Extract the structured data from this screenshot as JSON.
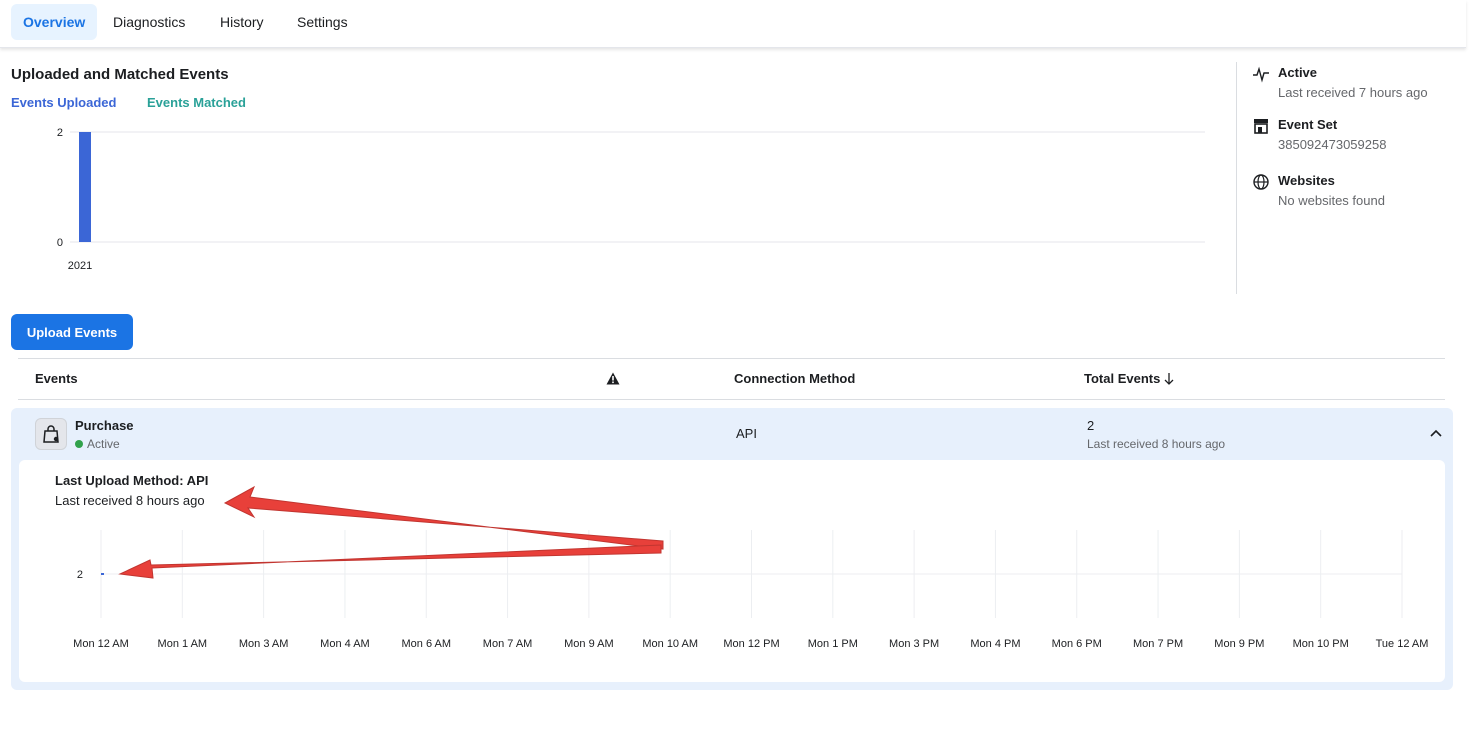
{
  "tabs": [
    {
      "label": "Overview",
      "active": true
    },
    {
      "label": "Diagnostics",
      "active": false
    },
    {
      "label": "History",
      "active": false
    },
    {
      "label": "Settings",
      "active": false
    }
  ],
  "overview_chart": {
    "title": "Uploaded and Matched Events",
    "legend": {
      "uploaded": "Events Uploaded",
      "matched": "Events Matched"
    }
  },
  "info_panel": {
    "active": {
      "title": "Active",
      "sub": "Last received 7 hours ago"
    },
    "event_set": {
      "title": "Event Set",
      "sub": "385092473059258"
    },
    "websites": {
      "title": "Websites",
      "sub": "No websites found"
    }
  },
  "upload_button": "Upload Events",
  "table": {
    "headers": {
      "events": "Events",
      "connection": "Connection Method",
      "total": "Total Events"
    },
    "row": {
      "name": "Purchase",
      "status": "Active",
      "method": "API",
      "total": "2",
      "total_sub": "Last received 8 hours ago"
    },
    "detail": {
      "title": "Last Upload Method: API",
      "sub": "Last received 8 hours ago"
    }
  },
  "colors": {
    "accent": "#1b74e4",
    "uploaded": "#3b66d6",
    "matched": "#2aa198",
    "arrow": "#e8403a"
  },
  "chart_data": [
    {
      "type": "bar",
      "title": "Uploaded and Matched Events",
      "categories": [
        "2021"
      ],
      "series": [
        {
          "name": "Events Uploaded",
          "values": [
            2
          ]
        },
        {
          "name": "Events Matched",
          "values": [
            0
          ]
        }
      ],
      "ylim": [
        0,
        2
      ],
      "yticks": [
        "0",
        "2"
      ],
      "grid": true,
      "legend": "top-left"
    },
    {
      "type": "line",
      "categories": [
        "Mon 12 AM",
        "Mon 1 AM",
        "Mon 3 AM",
        "Mon 4 AM",
        "Mon 6 AM",
        "Mon 7 AM",
        "Mon 9 AM",
        "Mon 10 AM",
        "Mon 12 PM",
        "Mon 1 PM",
        "Mon 3 PM",
        "Mon 4 PM",
        "Mon 6 PM",
        "Mon 7 PM",
        "Mon 9 PM",
        "Mon 10 PM",
        "Tue 12 AM"
      ],
      "series": [
        {
          "values": [
            2
          ]
        }
      ],
      "yticks": [
        "2"
      ],
      "grid": true
    }
  ]
}
